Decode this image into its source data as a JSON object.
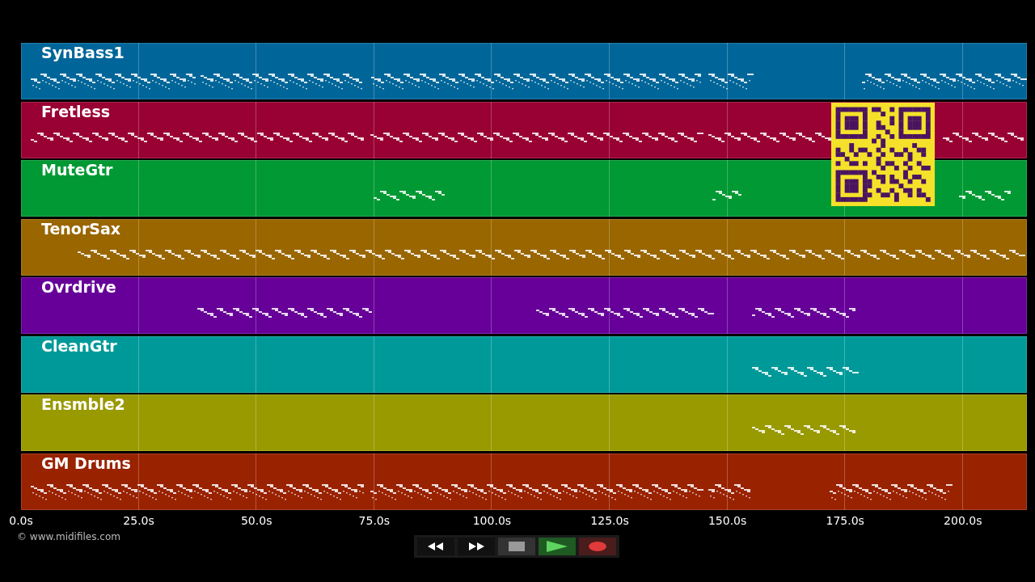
{
  "tracks": [
    {
      "name": "SynBass1",
      "color": "#006699"
    },
    {
      "name": "Fretless",
      "color": "#990033"
    },
    {
      "name": "MuteGtr",
      "color": "#009933"
    },
    {
      "name": "TenorSax",
      "color": "#996600"
    },
    {
      "name": "Ovrdrive",
      "color": "#660099"
    },
    {
      "name": "CleanGtr",
      "color": "#009999"
    },
    {
      "name": "Ensmble2",
      "color": "#999900"
    },
    {
      "name": "GM Drums",
      "color": "#992200"
    }
  ],
  "time_axis": {
    "ticks": [
      "0.0s",
      "25.0s",
      "50.0s",
      "75.0s",
      "100.0s",
      "125.0s",
      "150.0s",
      "175.0s",
      "200.0s"
    ]
  },
  "copyright": "© www.midifiles.com"
}
